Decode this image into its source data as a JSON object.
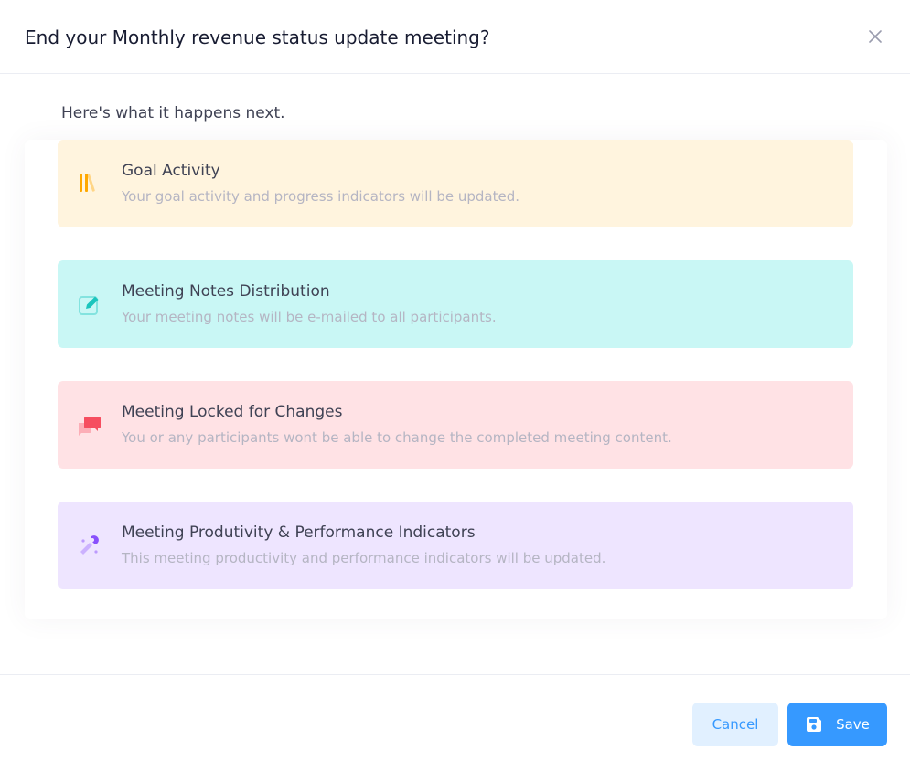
{
  "modal": {
    "title": "End your Monthly revenue status update meeting?",
    "close_icon": "close-icon"
  },
  "intro": "Here's what it happens next.",
  "items": [
    {
      "title": "Goal Activity",
      "description": "Your goal activity and progress indicators will be updated.",
      "icon": "library-icon",
      "bg_color": "#fff4de",
      "accent_color": "#ffa800"
    },
    {
      "title": "Meeting Notes Distribution",
      "description": "Your meeting notes will be e-mailed to all participants.",
      "icon": "edit-icon",
      "bg_color": "#c9f7f5",
      "accent_color": "#1bc5bd"
    },
    {
      "title": "Meeting Locked for Changes",
      "description": "You or any participants wont be able to change the completed meeting content.",
      "icon": "chat-icon",
      "bg_color": "#ffe2e5",
      "accent_color": "#f64e60"
    },
    {
      "title": "Meeting Produtivity & Performance Indicators",
      "description": "This meeting productivity and performance indicators will be updated.",
      "icon": "magic-icon",
      "bg_color": "#eee5ff",
      "accent_color": "#8950fc"
    }
  ],
  "footer": {
    "cancel_label": "Cancel",
    "save_label": "Save",
    "save_icon": "save-icon"
  }
}
